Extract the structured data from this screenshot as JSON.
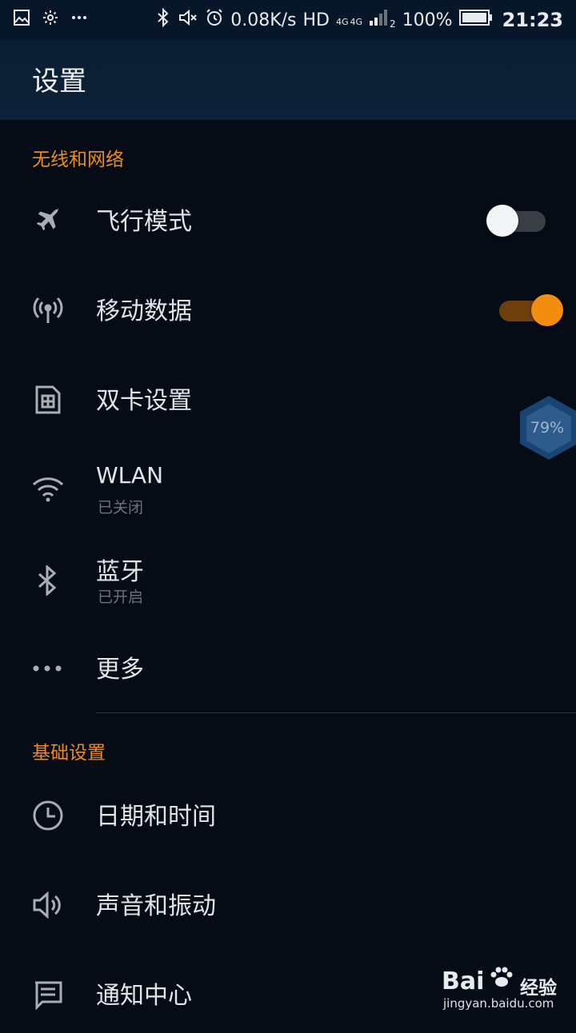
{
  "status_bar": {
    "network_speed": "0.08K/s",
    "hd": "HD",
    "net_type_1": "4G",
    "net_type_2": "4G",
    "sim_index": "2",
    "battery": "100%",
    "time": "21:23"
  },
  "header": {
    "title": "设置"
  },
  "sections": [
    {
      "header": "无线和网络",
      "items": [
        {
          "label": "飞行模式",
          "icon": "airplane-icon",
          "toggle": false
        },
        {
          "label": "移动数据",
          "icon": "antenna-icon",
          "toggle": true
        },
        {
          "label": "双卡设置",
          "icon": "sim-card-icon"
        },
        {
          "label": "WLAN",
          "sublabel": "已关闭",
          "icon": "wifi-icon"
        },
        {
          "label": "蓝牙",
          "sublabel": "已开启",
          "icon": "bluetooth-icon"
        },
        {
          "label": "更多",
          "icon": "more-icon"
        }
      ]
    },
    {
      "header": "基础设置",
      "items": [
        {
          "label": "日期和时间",
          "icon": "clock-icon"
        },
        {
          "label": "声音和振动",
          "icon": "speaker-icon"
        },
        {
          "label": "通知中心",
          "icon": "message-icon"
        }
      ]
    }
  ],
  "floating_widget": {
    "percent": "79%"
  },
  "watermark": {
    "brand": "Bai",
    "text": "经验",
    "url": "jingyan.baidu.com"
  },
  "colors": {
    "accent": "#f28d0f",
    "background": "#050c16",
    "appbar": "#0d2238"
  }
}
